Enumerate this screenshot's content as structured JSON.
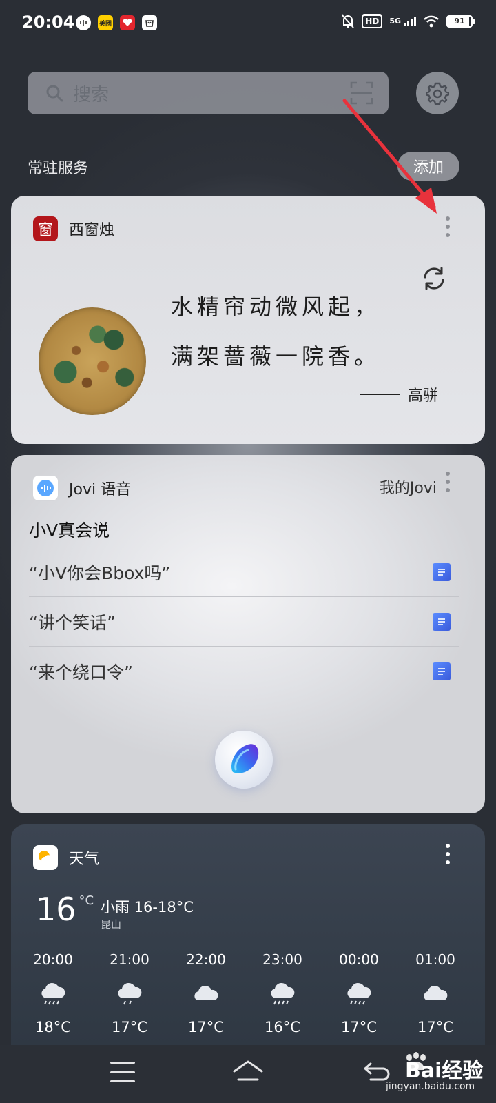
{
  "status_bar": {
    "time": "20:04",
    "network": "5G",
    "hd": "HD",
    "battery": "91",
    "left_apps": [
      "voice-app-icon",
      "meituan-app-icon",
      "heart-app-icon",
      "bag-app-icon"
    ],
    "meituan_label": "美团"
  },
  "search": {
    "placeholder": "搜索"
  },
  "section": {
    "title": "常驻服务",
    "add_label": "添加"
  },
  "poem_card": {
    "app_name": "西窗烛",
    "app_icon_char": "窗",
    "line1": "水精帘动微风起，",
    "line2": "满架蔷薇一院香。",
    "author": "高骈"
  },
  "jovi_card": {
    "app_name": "Jovi 语音",
    "my_jovi": "我的Jovi",
    "subtitle": "小V真会说",
    "items": [
      {
        "text": "“小V你会Bbox吗”"
      },
      {
        "text": "“讲个笑话”"
      },
      {
        "text": "“来个绕口令”"
      }
    ]
  },
  "weather_card": {
    "app_name": "天气",
    "temp": "16",
    "temp_unit": "°C",
    "desc": "小雨 16-18°C",
    "location": "昆山",
    "hours": [
      {
        "time": "20:00",
        "temp": "18°C",
        "icon": "rain-cloud-icon"
      },
      {
        "time": "21:00",
        "temp": "17°C",
        "icon": "light-rain-cloud-icon"
      },
      {
        "time": "22:00",
        "temp": "17°C",
        "icon": "cloud-icon"
      },
      {
        "time": "23:00",
        "temp": "16°C",
        "icon": "rain-cloud-icon"
      },
      {
        "time": "00:00",
        "temp": "17°C",
        "icon": "rain-cloud-icon"
      },
      {
        "time": "01:00",
        "temp": "17°C",
        "icon": "cloud-icon"
      }
    ]
  },
  "watermark": {
    "brand": "Bai经验",
    "url": "jingyan.baidu.com"
  },
  "colors": {
    "annotation_arrow": "#e8323c",
    "poem_badge": "#b3161b",
    "jovi_doc_icon": "#3b5bdb"
  }
}
